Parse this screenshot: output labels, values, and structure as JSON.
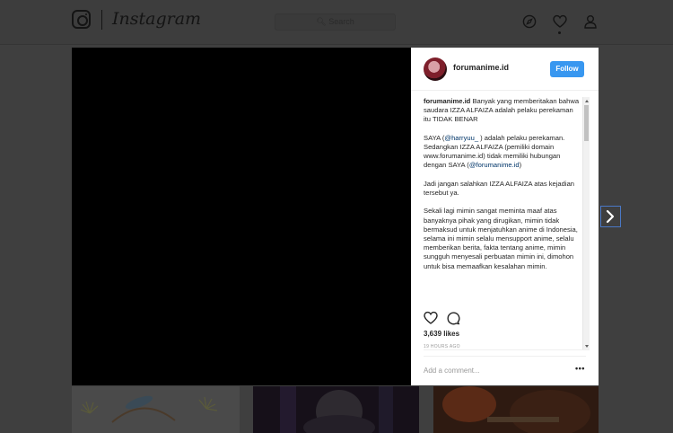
{
  "header": {
    "wordmark": "Instagram",
    "search_placeholder": "Search",
    "nav_icons": [
      "compass-icon",
      "heart-icon",
      "profile-icon"
    ]
  },
  "post": {
    "username": "forumanime.id",
    "follow_label": "Follow",
    "caption": {
      "user": "forumanime.id",
      "p1_text": " Banyak yang memberitakan bahwa saudara IZZA ALFAIZA adalah pelaku perekaman itu TIDAK BENAR",
      "p2_a": "SAYA (",
      "p2_mention": "@harryuu_",
      "p2_b": " ) adalah pelaku perekaman.",
      "p2_c": "Sedangkan IZZA ALFAIZA (pemiliki domain www.forumanime.id) tidak memiliki hubungan dengan SAYA (",
      "p2_mention2": "@forumanime.id",
      "p2_d": ")",
      "p3": "Jadi jangan salahkan IZZA ALFAIZA atas kejadian tersebut ya.",
      "p4": "Sekali lagi mimin sangat meminta maaf atas banyaknya pihak yang dirugikan, mimin tidak bermaksud untuk menjatuhkan anime di Indonesia, selama ini mimin selalu mensupport anime, selalu memberikan berita, fakta tentang anime, mimin sungguh menyesali perbuatan mimin ini, dimohon untuk bisa memaafkan kesalahan mimin."
    },
    "likes": "3,639 likes",
    "time": "19 HOURS AGO",
    "comment_placeholder": "Add a comment...",
    "more_label": "•••"
  },
  "colors": {
    "accent": "#3897f0",
    "link": "#003569",
    "overlay": "#3f3f3f"
  }
}
